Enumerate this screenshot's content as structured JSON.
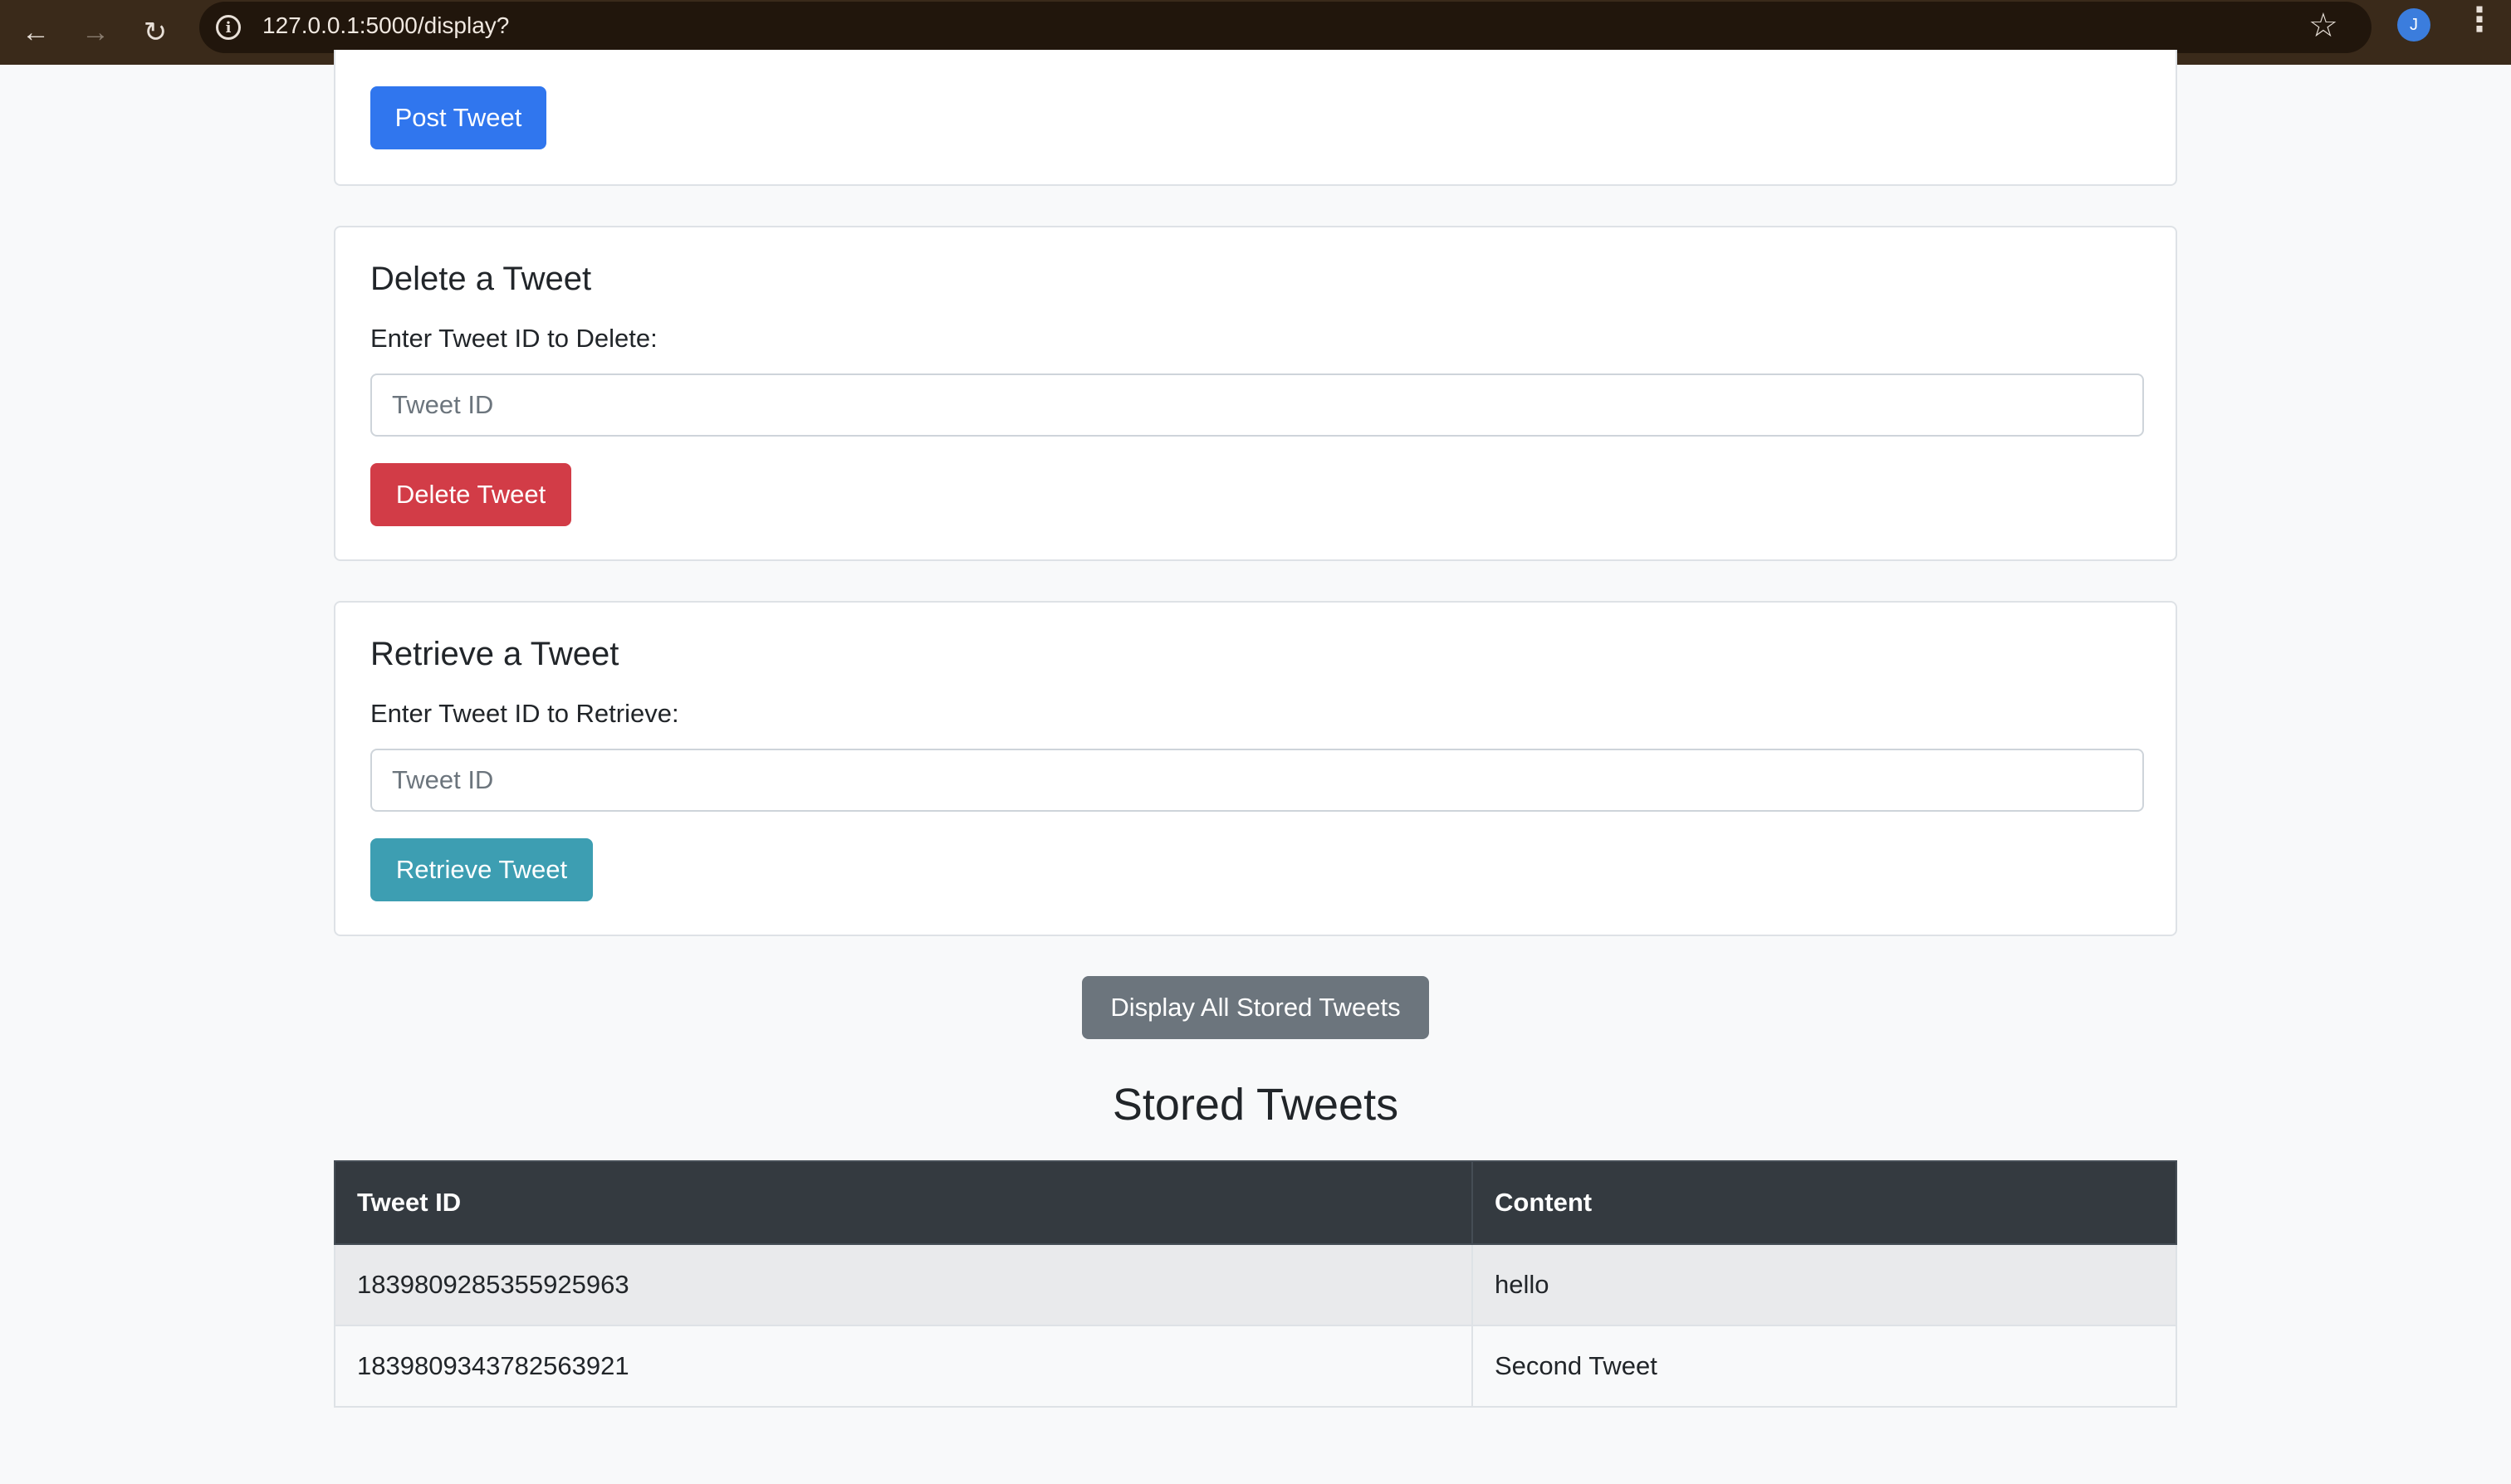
{
  "browser": {
    "url": "127.0.0.1:5000/display?",
    "profile_initial": "J"
  },
  "post_card": {
    "button_label": "Post Tweet"
  },
  "delete_card": {
    "title": "Delete a Tweet",
    "label": "Enter Tweet ID to Delete:",
    "placeholder": "Tweet ID",
    "value": "",
    "button_label": "Delete Tweet"
  },
  "retrieve_card": {
    "title": "Retrieve a Tweet",
    "label": "Enter Tweet ID to Retrieve:",
    "placeholder": "Tweet ID",
    "value": "",
    "button_label": "Retrieve Tweet"
  },
  "display_button_label": "Display All Stored Tweets",
  "stored": {
    "title": "Stored Tweets",
    "headers": [
      "Tweet ID",
      "Content"
    ],
    "rows": [
      [
        "1839809285355925963",
        "hello"
      ],
      [
        "1839809343782563921",
        "Second Tweet"
      ]
    ]
  },
  "colors": {
    "primary": "#3076ee",
    "danger": "#d23c47",
    "info": "#3d9eb2",
    "secondary": "#6c757d",
    "table_header": "#343a40"
  },
  "icons": {
    "back": "back-arrow-icon",
    "forward": "forward-arrow-icon",
    "reload": "reload-icon",
    "site_info": "info-icon",
    "bookmark": "star-icon",
    "menu": "kebab-menu-icon"
  }
}
